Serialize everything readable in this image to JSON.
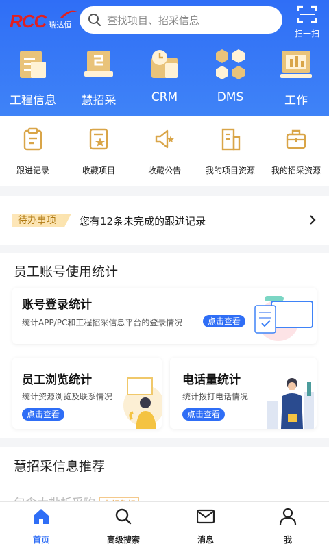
{
  "header": {
    "logo_text": "RCC",
    "logo_cn": "瑞达恒",
    "search_placeholder": "查找项目、招采信息",
    "scan_label": "扫一扫"
  },
  "top_nav": [
    {
      "label": "工程信息",
      "icon": "document-icon"
    },
    {
      "label": "慧招采",
      "icon": "certificate-icon"
    },
    {
      "label": "CRM",
      "icon": "clock-folder-icon"
    },
    {
      "label": "DMS",
      "icon": "hexagon-network-icon"
    },
    {
      "label": "工作",
      "icon": "chart-board-icon"
    }
  ],
  "quick_links": [
    {
      "label": "跟进记录",
      "icon": "clipboard-icon"
    },
    {
      "label": "收藏项目",
      "icon": "star-bookmark-icon"
    },
    {
      "label": "收藏公告",
      "icon": "megaphone-star-icon"
    },
    {
      "label": "我的项目资源",
      "icon": "building-icon"
    },
    {
      "label": "我的招采资源",
      "icon": "briefcase-icon"
    }
  ],
  "todo": {
    "tag": "待办事项",
    "text": "您有12条未完成的跟进记录"
  },
  "stats": {
    "title": "员工账号使用统计",
    "login": {
      "title": "账号登录统计",
      "desc": "统计APP/PC和工程招采信息平台的登录情况",
      "button": "点击查看"
    },
    "browse": {
      "title": "员工浏览统计",
      "desc": "统计资源浏览及联系情况",
      "button": "点击查看"
    },
    "phone": {
      "title": "电话量统计",
      "desc": "统计拨打电话情况",
      "button": "点击查看"
    }
  },
  "recommend": {
    "title": "慧招采信息推荐",
    "peek_text": "包含大批析采购",
    "peek_tag": "大额急标"
  },
  "tabbar": [
    {
      "label": "首页",
      "icon": "home-icon",
      "active": true
    },
    {
      "label": "高级搜索",
      "icon": "search-icon",
      "active": false
    },
    {
      "label": "消息",
      "icon": "mail-icon",
      "active": false
    },
    {
      "label": "我",
      "icon": "user-icon",
      "active": false
    }
  ],
  "colors": {
    "primary": "#2f6ef6",
    "gold": "#d9a548",
    "logo_red": "#e02020"
  }
}
